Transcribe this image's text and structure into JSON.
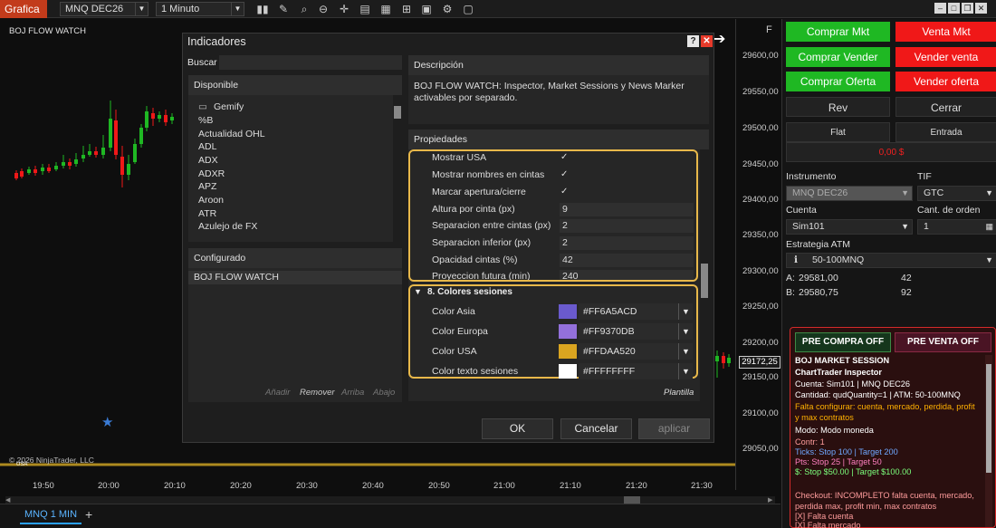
{
  "toolbar": {
    "app_title": "Grafica",
    "instrument": "MNQ DEC26",
    "interval": "1 Minuto",
    "icons": [
      "bars-icon",
      "pencil-icon",
      "zoom-icon",
      "zoom-out-icon",
      "crosshair-icon",
      "properties-icon",
      "strategies-icon",
      "chart-trader-icon",
      "templates-icon",
      "drawing-tools-icon",
      "snapshot-icon",
      "share-icon"
    ]
  },
  "chart": {
    "label": "BOJ FLOW WATCH",
    "copyright": "© 2026 NinjaTrader, LLC",
    "session_label": "USA",
    "panel_f": "F",
    "current_price": "29172,25",
    "price_ticks": [
      "29600,00",
      "29550,00",
      "29500,00",
      "29450,00",
      "29400,00",
      "29350,00",
      "29300,00",
      "29250,00",
      "29200,00",
      "29150,00",
      "29100,00",
      "29050,00"
    ],
    "time_ticks": [
      "19:50",
      "20:00",
      "20:10",
      "20:20",
      "20:30",
      "20:40",
      "20:50",
      "21:00",
      "21:10",
      "21:20",
      "21:30"
    ],
    "colors": {
      "up": "#1fb823",
      "down": "#f01818",
      "session": "#c9a022",
      "marker": "#3a7bd5"
    }
  },
  "tabs": {
    "active": "MNQ 1 MIN",
    "add": "+"
  },
  "dialog": {
    "title": "Indicadores",
    "help": "?",
    "close": "✕",
    "search_label": "Buscar",
    "search_value": "",
    "available_header": "Disponible",
    "available": [
      "Gemify",
      "%B",
      "Actualidad OHL",
      "ADL",
      "ADX",
      "ADXR",
      "APZ",
      "Aroon",
      "ATR",
      "Azulejo de FX"
    ],
    "configured_header": "Configurado",
    "configured": [
      "BOJ FLOW WATCH"
    ],
    "actions": {
      "add": "Añadir",
      "remove": "Remover",
      "up": "Arriba",
      "down": "Abajo"
    },
    "description_header": "Descripción",
    "description": "BOJ FLOW WATCH: Inspector, Market Sessions y News Marker activables por separado.",
    "properties_header": "Propiedades",
    "properties": [
      {
        "label": "Mostrar USA",
        "value": "✓"
      },
      {
        "label": "Mostrar nombres en cintas",
        "value": "✓"
      },
      {
        "label": "Marcar apertura/cierre",
        "value": "✓"
      },
      {
        "label": "Altura por cinta (px)",
        "value": "9"
      },
      {
        "label": "Separacion entre cintas (px)",
        "value": "2"
      },
      {
        "label": "Separacion inferior (px)",
        "value": "2"
      },
      {
        "label": "Opacidad cintas (%)",
        "value": "42"
      },
      {
        "label": "Proyeccion futura (min)",
        "value": "240"
      }
    ],
    "color_section": "8. Colores sesiones",
    "colors": [
      {
        "label": "Color Asia",
        "hex": "#FF6A5ACD",
        "swatch": "#6a5acd"
      },
      {
        "label": "Color Europa",
        "hex": "#FF9370DB",
        "swatch": "#9370db"
      },
      {
        "label": "Color USA",
        "hex": "#FFDAA520",
        "swatch": "#daa520"
      },
      {
        "label": "Color texto sesiones",
        "hex": "#FFFFFFFF",
        "swatch": "#ffffff"
      }
    ],
    "template_link": "Plantilla",
    "ok": "OK",
    "cancel": "Cancelar",
    "apply": "aplicar"
  },
  "side": {
    "buy_mkt": "Comprar Mkt",
    "sell_mkt": "Venta Mkt",
    "buy_ask": "Comprar Vender",
    "sell_ask": "Vender venta",
    "buy_bid": "Comprar Oferta",
    "sell_bid": "Vender oferta",
    "rev": "Rev",
    "close": "Cerrar",
    "flat": "Flat",
    "entry": "Entrada",
    "pnl": "0,00 $",
    "instrument_label": "Instrumento",
    "instrument": "MNQ DEC26",
    "tif_label": "TIF",
    "tif": "GTC",
    "account_label": "Cuenta",
    "account": "Sim101",
    "qty_label": "Cant. de orden",
    "qty": "1",
    "atm_label": "Estrategia ATM",
    "atm": "50-100MNQ",
    "ask_label": "A:",
    "ask_price": "29581,00",
    "ask_size": "42",
    "bid_label": "B:",
    "bid_price": "29580,75",
    "bid_size": "92"
  },
  "atp": {
    "pre_buy": "PRE COMPRA OFF",
    "pre_sell": "PRE VENTA OFF",
    "lines": [
      {
        "text": "BOJ MARKET SESSION",
        "color": "#ffffff",
        "bold": true
      },
      {
        "text": "ChartTrader Inspector",
        "color": "#ffffff",
        "bold": true
      },
      {
        "text": "Cuenta: Sim101 | MNQ DEC26",
        "color": "#ffffff",
        "bold": false
      },
      {
        "text": "Cantidad: qudQuantity=1 | ATM: 50-100MNQ",
        "color": "#ffffff",
        "bold": false
      },
      {
        "text": "Falta configurar: cuenta, mercado, perdida, profit",
        "color": "#ffb000",
        "bold": false
      },
      {
        "text": "y max contratos",
        "color": "#ffb000",
        "bold": false
      },
      {
        "text": "Modo: Modo moneda",
        "color": "#ffffff",
        "bold": false
      },
      {
        "text": "Contr: 1",
        "color": "#ff9c9c",
        "bold": false
      },
      {
        "text": "Ticks: Stop 100 | Target 200",
        "color": "#6fa8ff",
        "bold": false
      },
      {
        "text": "Pts: Stop 25 | Target 50",
        "color": "#ff80c0",
        "bold": false
      },
      {
        "text": "$: Stop $50.00 | Target $100.00",
        "color": "#7cff7c",
        "bold": false
      },
      {
        "text": "Checkout: INCOMPLETO falta cuenta, mercado,",
        "color": "#ff9c9c",
        "bold": false
      },
      {
        "text": "perdida max, profit min, max contratos",
        "color": "#ff9c9c",
        "bold": false
      },
      {
        "text": "[X] Falta cuenta",
        "color": "#ff9c9c",
        "bold": false
      },
      {
        "text": "[X] Falta mercado",
        "color": "#ff9c9c",
        "bold": false
      }
    ]
  }
}
